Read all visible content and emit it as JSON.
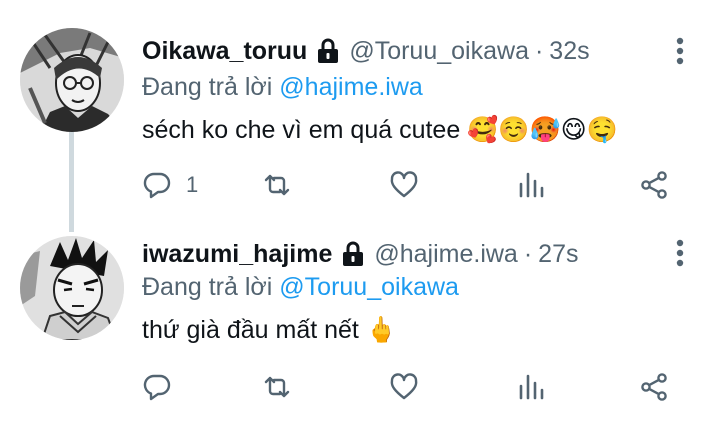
{
  "tweets": [
    {
      "display_name": "Oikawa_toruu",
      "protected": true,
      "handle": "@Toruu_oikawa",
      "separator": "·",
      "time": "32s",
      "reply_prefix": "Đang trả lời",
      "reply_to": "@hajime.iwa",
      "text": "séch ko che vì em quá cutee 🥰☺️🥵😋🤤",
      "reply_count": "1",
      "icons": [
        "lock-icon",
        "more-vertical-icon",
        "reply-icon",
        "retweet-icon",
        "like-icon",
        "stats-icon",
        "share-icon"
      ]
    },
    {
      "display_name": "iwazumi_hajime",
      "protected": true,
      "handle": "@hajime.iwa",
      "separator": "·",
      "time": "27s",
      "reply_prefix": "Đang trả lời",
      "reply_to": "@Toruu_oikawa",
      "text": "thứ già đầu mất nết 🖕",
      "reply_count": "",
      "icons": [
        "lock-icon",
        "more-vertical-icon",
        "reply-icon",
        "retweet-icon",
        "like-icon",
        "stats-icon",
        "share-icon"
      ]
    }
  ],
  "colors": {
    "text": "#0f1419",
    "secondary": "#536471",
    "mention": "#1d9bf0",
    "thread_line": "#cfd9de"
  }
}
